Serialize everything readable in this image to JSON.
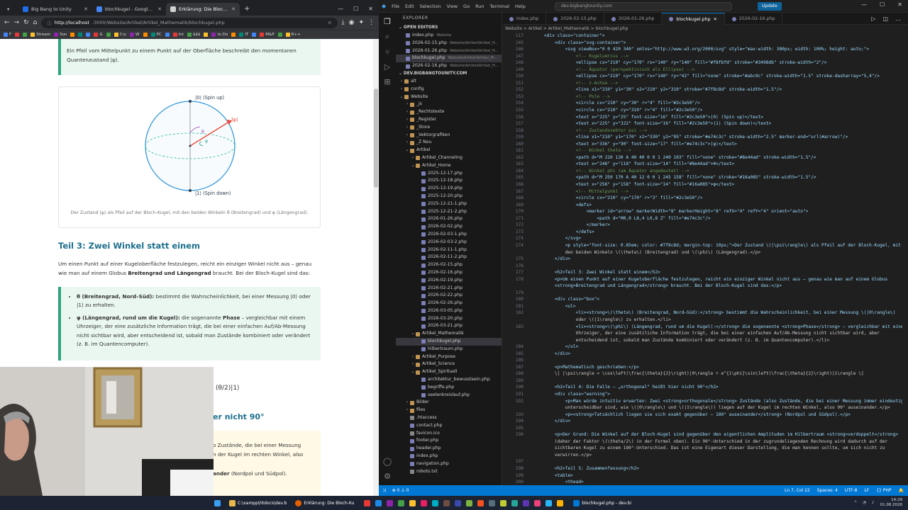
{
  "browser": {
    "tabs": [
      {
        "label": "Big Bang to Unity",
        "color": "#1f6feb"
      },
      {
        "label": "blochkugel - Google Suche",
        "color": "#4285f4"
      },
      {
        "label": "Erklärung: Die Bloch-Kugel",
        "color": "#d0d0d0"
      }
    ],
    "url_host": "http://localhost",
    "url_path": ":3000/Website/Artikel/Artikel_Mathematik/blochkugel.php",
    "bookmarks": [
      "F",
      "",
      "",
      "Stream",
      "Son",
      "",
      "",
      "",
      "G",
      "",
      "Cry",
      "W",
      "",
      "PC",
      "",
      "Int",
      "$$$",
      "",
      "to Do",
      "",
      "IT",
      "",
      "M&P",
      "",
      "R++"
    ],
    "content": {
      "intro": "Ein Pfeil vom Mittelpunkt zu einem Punkt auf der Oberfläche beschreibt den momentanen Quantenzustand |ψ⟩.",
      "fig_labels": {
        "top": "|0⟩ (Spin up)",
        "bottom": "|1⟩ (Spin down)",
        "psi": "|ψ⟩",
        "theta": "θ",
        "phi": "φ"
      },
      "fig_caption": "Der Zustand |ψ⟩ als Pfeil auf der Bloch-Kugel, mit den beiden Winkeln θ (Breitengrad) und φ (Längengrad).",
      "heading3": "Teil 3: Zwei Winkel statt einem",
      "para_pre": "Um einen Punkt auf einer Kugeloberfläche festzulegen, reicht ein einziger Winkel nicht aus – genau wie man auf einem Globus ",
      "para_bold": "Breitengrad und Längengrad",
      "para_post": " braucht. Bei der Bloch-Kugel sind das:",
      "li1_bold": "θ (Breitengrad, Nord–Süd):",
      "li1_text": " bestimmt die Wahrscheinlichkeit, bei einer Messung |0⟩ oder |1⟩ zu erhalten.",
      "li2_bold": "φ (Längengrad, rund um die Kugel):",
      "li2_text": " die sogenannte ",
      "li2_bold2": "Phase",
      "li2_text2": " – vergleichbar mit einem Uhrzeiger, der eine zusätzliche Information trägt, die bei einer einfachen Auf/Ab-Messung nicht sichtbar wird, aber entscheidend ist, sobald man Zustände kombiniert oder verändert (z. B. im Quantencomputer).",
      "formula_frag": "(θ/2)|1⟩",
      "heading4_frag": "er nicht 90°",
      "warn1": "o Zustände, die bei einer Messung",
      "warn2": "n der Kugel im rechten Winkel, also",
      "warn3_bold": "ander",
      "warn3_text": " (Nordpol und Südpol)."
    }
  },
  "vscode": {
    "menu": [
      "File",
      "Edit",
      "Selection",
      "View",
      "Go",
      "Run",
      "Terminal",
      "Help"
    ],
    "search": "dev.bigbangtounity.com",
    "update_label": "Update",
    "explorer_title": "EXPLORER",
    "open_editors_title": "OPEN EDITORS",
    "open_editors": [
      {
        "name": "index.php",
        "note": "Website"
      },
      {
        "name": "2026-02-15.php",
        "note": "Website\\Artikel\\Artikel_H..."
      },
      {
        "name": "2026-01-26.php",
        "note": "Website\\Artikel\\Artikel_H..."
      },
      {
        "name": "blochkugel.php",
        "note": "Website\\Artikel\\Artikel_M..."
      },
      {
        "name": "2026-02-16.php",
        "note": "Website\\Artikel\\Artikel_H..."
      }
    ],
    "project_title": "DEV.BIGBANGTOUNITY.COM",
    "tree": [
      {
        "d": 0,
        "t": "f",
        "n": "alt"
      },
      {
        "d": 0,
        "t": "f",
        "n": "config"
      },
      {
        "d": 0,
        "t": "o",
        "n": "Website"
      },
      {
        "d": 1,
        "t": "f",
        "n": "_js"
      },
      {
        "d": 1,
        "t": "f",
        "n": "_Rechtstexte"
      },
      {
        "d": 1,
        "t": "f",
        "n": "_Register"
      },
      {
        "d": 1,
        "t": "f",
        "n": "_Store"
      },
      {
        "d": 1,
        "t": "f",
        "n": "_Vektorgrafiken"
      },
      {
        "d": 1,
        "t": "f",
        "n": "_Z Neu"
      },
      {
        "d": 1,
        "t": "o",
        "n": "Artikel"
      },
      {
        "d": 2,
        "t": "f",
        "n": "Artikel_Channeling"
      },
      {
        "d": 2,
        "t": "o",
        "n": "Artikel_Home"
      },
      {
        "d": 3,
        "t": "p",
        "n": "2025-12-17.php"
      },
      {
        "d": 3,
        "t": "p",
        "n": "2025-12-18.php"
      },
      {
        "d": 3,
        "t": "p",
        "n": "2025-12-19.php"
      },
      {
        "d": 3,
        "t": "p",
        "n": "2025-12-20.php"
      },
      {
        "d": 3,
        "t": "p",
        "n": "2025-12-21-1.php"
      },
      {
        "d": 3,
        "t": "p",
        "n": "2025-12-21-2.php"
      },
      {
        "d": 3,
        "t": "p",
        "n": "2026-01-26.php"
      },
      {
        "d": 3,
        "t": "p",
        "n": "2026-02-02.php"
      },
      {
        "d": 3,
        "t": "p",
        "n": "2026-02-03-1.php"
      },
      {
        "d": 3,
        "t": "p",
        "n": "2026-02-03-2.php"
      },
      {
        "d": 3,
        "t": "p",
        "n": "2026-02-11-1.php"
      },
      {
        "d": 3,
        "t": "p",
        "n": "2026-02-11-2.php"
      },
      {
        "d": 3,
        "t": "p",
        "n": "2026-02-15.php"
      },
      {
        "d": 3,
        "t": "p",
        "n": "2026-02-16.php"
      },
      {
        "d": 3,
        "t": "p",
        "n": "2026-02-19.php"
      },
      {
        "d": 3,
        "t": "p",
        "n": "2026-02-21.php"
      },
      {
        "d": 3,
        "t": "p",
        "n": "2026-02-22.php"
      },
      {
        "d": 3,
        "t": "p",
        "n": "2026-02-26.php"
      },
      {
        "d": 3,
        "t": "p",
        "n": "2026-03-05.php"
      },
      {
        "d": 3,
        "t": "p",
        "n": "2026-03-20.php"
      },
      {
        "d": 3,
        "t": "p",
        "n": "2026-03-21.php"
      },
      {
        "d": 2,
        "t": "o",
        "n": "Artikel_Mathematik"
      },
      {
        "d": 3,
        "t": "p",
        "n": "blochkugel.php",
        "sel": true
      },
      {
        "d": 3,
        "t": "p",
        "n": "hilbertraum.php"
      },
      {
        "d": 2,
        "t": "f",
        "n": "Artikel_Purpose"
      },
      {
        "d": 2,
        "t": "f",
        "n": "Artikel_Science"
      },
      {
        "d": 2,
        "t": "o",
        "n": "Artikel_Spirituell"
      },
      {
        "d": 3,
        "t": "p",
        "n": "architektur_bewusstsein.php"
      },
      {
        "d": 3,
        "t": "p",
        "n": "begriffe.php"
      },
      {
        "d": 3,
        "t": "p",
        "n": "seelenkreislauf.php"
      },
      {
        "d": 1,
        "t": "f",
        "n": "Bilder"
      },
      {
        "d": 1,
        "t": "f",
        "n": "files"
      },
      {
        "d": 1,
        "t": "x",
        "n": ".htaccess"
      },
      {
        "d": 1,
        "t": "p",
        "n": "contact.php"
      },
      {
        "d": 1,
        "t": "x",
        "n": "favicon.ico"
      },
      {
        "d": 1,
        "t": "p",
        "n": "footer.php"
      },
      {
        "d": 1,
        "t": "p",
        "n": "header.php"
      },
      {
        "d": 1,
        "t": "p",
        "n": "index.php"
      },
      {
        "d": 1,
        "t": "p",
        "n": "navigation.php"
      },
      {
        "d": 1,
        "t": "x",
        "n": "robots.txt"
      }
    ],
    "tabs": [
      {
        "name": "index.php"
      },
      {
        "name": "2026-02-15.php"
      },
      {
        "name": "2026-01-26.php"
      },
      {
        "name": "blochkugel.php",
        "active": true
      },
      {
        "name": "2026-02-16.php"
      }
    ],
    "breadcrumb": "Website > Artikel > Artikel_Mathematik > blochkugel.php",
    "code": [
      {
        "n": "117",
        "l": "    <div class=\"container\">"
      },
      {
        "n": "145",
        "l": "        <div class=\"svg-container\">"
      },
      {
        "n": "146",
        "l": "            <svg viewBox=\"0 0 420 340\" xmlns=\"http://www.w3.org/2000/svg\" style=\"max-width: 380px; width: 100%; height: auto;\">"
      },
      {
        "n": "147",
        "l": "                <!-- Kugelumriss -->"
      },
      {
        "n": "148",
        "l": "                <ellipse cx=\"210\" cy=\"170\" rx=\"140\" ry=\"140\" fill=\"#f8fbfd\" stroke=\"#3498db\" stroke-width=\"2\"/>"
      },
      {
        "n": "149",
        "l": "                <!-- Äquator (perspektivisch als Ellipse) -->"
      },
      {
        "n": "150",
        "l": "                <ellipse cx=\"210\" cy=\"170\" rx=\"140\" ry=\"42\" fill=\"none\" stroke=\"#abc9c\" stroke-width=\"1.5\" stroke-dasharray=\"5,4\"/>"
      },
      {
        "n": "151",
        "l": "                <!-- z-Achse -->"
      },
      {
        "n": "152",
        "l": "                <line x1=\"210\" y1=\"30\" x2=\"210\" y2=\"310\" stroke=\"#7f8c8d\" stroke-width=\"1.5\"/>"
      },
      {
        "n": "153",
        "l": "                <!-- Pole -->"
      },
      {
        "n": "154",
        "l": "                <circle cx=\"210\" cy=\"30\" r=\"4\" fill=\"#2c3e50\"/>"
      },
      {
        "n": "155",
        "l": "                <circle cx=\"210\" cy=\"310\" r=\"4\" fill=\"#2c3e50\"/>"
      },
      {
        "n": "156",
        "l": "                <text x=\"225\" y=\"25\" font-size=\"16\" fill=\"#2c3e50\">|0⟩ (Spin up)</text>"
      },
      {
        "n": "157",
        "l": "                <text x=\"225\" y=\"322\" font-size=\"16\" fill=\"#2c3e50\">|1⟩ (Spin down)</text>"
      },
      {
        "n": "158",
        "l": "                <!-- Zustandsvektor psi -->"
      },
      {
        "n": "159",
        "l": "                <line x1=\"210\" y1=\"170\" x2=\"330\" y2=\"95\" stroke=\"#e74c3c\" stroke-width=\"2.5\" marker-end=\"url(#arrow)\"/>"
      },
      {
        "n": "160",
        "l": "                <text x=\"336\" y=\"90\" font-size=\"17\" fill=\"#e74c3c\">|ψ⟩</text>"
      },
      {
        "n": "161",
        "l": "                <!-- Winkel theta -->"
      },
      {
        "n": "162",
        "l": "                <path d=\"M 210 130 A 40 40 0 0 1 240 103\" fill=\"none\" stroke=\"#8e44ad\" stroke-width=\"1.5\"/>"
      },
      {
        "n": "163",
        "l": "                <text x=\"246\" y=\"118\" font-size=\"14\" fill=\"#8e44ad\">θ</text>"
      },
      {
        "n": "164",
        "l": "                <!-- Winkel phi (am Äquator angedeutet) -->"
      },
      {
        "n": "165",
        "l": "                <path d=\"M 250 170 A 40 12 0 0 1 245 158\" fill=\"none\" stroke=\"#16a085\" stroke-width=\"1.5\"/>"
      },
      {
        "n": "166",
        "l": "                <text x=\"256\" y=\"158\" font-size=\"14\" fill=\"#16a085\">φ</text>"
      },
      {
        "n": "167",
        "l": "                <!-- Mittelpunkt -->"
      },
      {
        "n": "168",
        "l": "                <circle cx=\"210\" cy=\"170\" r=\"3\" fill=\"#2c3e50\"/>"
      },
      {
        "n": "169",
        "l": "                <defs>"
      },
      {
        "n": "170",
        "l": "                    <marker id=\"arrow\" markerWidth=\"8\" markerHeight=\"8\" refX=\"4\" refY=\"4\" orient=\"auto\">"
      },
      {
        "n": "171",
        "l": "                        <path d=\"M0,0 L8,4 L0,8 Z\" fill=\"#e74c3c\"/>"
      },
      {
        "n": "172",
        "l": "                    </marker>"
      },
      {
        "n": "173",
        "l": "                </defs>"
      },
      {
        "n": "174",
        "l": "            </svg>"
      },
      {
        "n": "174",
        "l": "            <p style=\"font-size: 0.85em; color: #7f8c8d; margin-top: 10px;\">Der Zustand \\(|\\psi\\rangle\\) als Pfeil auf der Bloch-Kugel, mit"
      },
      {
        "n": "",
        "l": "            den beiden Winkeln \\(\\theta\\) (Breitengrad) und \\(\\phi\\) (Längengrad).</p>"
      },
      {
        "n": "175",
        "l": "        </div>"
      },
      {
        "n": "176",
        "l": ""
      },
      {
        "n": "177",
        "l": "        <h2>Teil 3: Zwei Winkel statt einem</h2>"
      },
      {
        "n": "178",
        "l": "        <p>Um einen Punkt auf einer Kugeloberfläche festzulegen, reicht ein einziger Winkel nicht aus – genau wie man auf einem Globus"
      },
      {
        "n": "",
        "l": "        <strong>Breitengrad und Längengrad</strong> braucht. Bei der Bloch-Kugel sind das:</p>"
      },
      {
        "n": "179",
        "l": ""
      },
      {
        "n": "180",
        "l": "        <div class=\"box\">"
      },
      {
        "n": "181",
        "l": "            <ul>"
      },
      {
        "n": "182",
        "l": "                <li><strong>\\(\\theta\\) (Breitengrad, Nord–Süd):</strong> bestimmt die Wahrscheinlichkeit, bei einer Messung \\(|0\\rangle\\)"
      },
      {
        "n": "",
        "l": "                oder \\(|1\\rangle\\) zu erhalten.</li>"
      },
      {
        "n": "183",
        "l": "                <li><strong>\\(\\phi\\) (Längengrad, rund um die Kugel):</strong> die sogenannte <strong>Phase</strong> – vergleichbar mit einem"
      },
      {
        "n": "",
        "l": "                Uhrzeiger, der eine zusätzliche Information trägt, die bei einer einfachen Auf/Ab-Messung nicht sichtbar wird, aber"
      },
      {
        "n": "",
        "l": "                entscheidend ist, sobald man Zustände kombiniert oder verändert (z. B. im Quantencomputer).</li>"
      },
      {
        "n": "184",
        "l": "            </ul>"
      },
      {
        "n": "185",
        "l": "        </div>"
      },
      {
        "n": "186",
        "l": ""
      },
      {
        "n": "187",
        "l": "        <p>Mathematisch geschrieben:</p>"
      },
      {
        "n": "188",
        "l": "        \\[ |\\psi\\rangle = \\cos\\left(\\frac{\\theta}{2}\\right)|0\\rangle + e^{i\\phi}\\sin\\left(\\frac{\\theta}{2}\\right)|1\\rangle \\]"
      },
      {
        "n": "189",
        "l": ""
      },
      {
        "n": "190",
        "l": "        <h2>Teil 4: Die Falle – „orthogonal\" heißt hier nicht 90°</h2>"
      },
      {
        "n": "191",
        "l": "        <div class=\"warning\">"
      },
      {
        "n": "192",
        "l": "            <p>Man würde intuitiv erwarten: Zwei <strong>orthogonale</strong> Zustände (also Zustände, die bei einer Messung immer eindeutig"
      },
      {
        "n": "",
        "l": "            unterscheidbar sind, wie \\(|0\\rangle\\) und \\(|1\\rangle\\)) liegen auf der Kugel im rechten Winkel, also 90° auseinander.</p>"
      },
      {
        "n": "193",
        "l": "            <p><strong>Tatsächlich liegen sie sich exakt gegenüber – 180° auseinander</strong> (Nordpol und Südpol).</p>"
      },
      {
        "n": "194",
        "l": "        </div>"
      },
      {
        "n": "195",
        "l": ""
      },
      {
        "n": "196",
        "l": "        <p>Der Grund: Die Winkel auf der Bloch-Kugel sind gegenüber den eigentlichen Amplituden im Hilbertraum <strong>verdoppelt</strong>"
      },
      {
        "n": "",
        "l": "        (daher der Faktor \\(\\theta/2\\) in der Formel oben). Ein 90°-Unterschied in der zugrundeliegenden Rechnung wird dadurch auf der"
      },
      {
        "n": "",
        "l": "        sichtbaren Kugel zu einem 180°-Unterschied. Das ist eine Eigenart dieser Darstellung, die man kennen sollte, um sich nicht zu"
      },
      {
        "n": "",
        "l": "        verwirren.</p>"
      },
      {
        "n": "197",
        "l": ""
      },
      {
        "n": "198",
        "l": "        <h2>Teil 5: Zusammenfassung</h2>"
      },
      {
        "n": "199",
        "l": "        <table>"
      },
      {
        "n": "200",
        "l": "            <thead>"
      }
    ],
    "status_left": "⊗ 0 ⚠ 0",
    "status_right": [
      "Ln 7, Col 22",
      "Spaces: 4",
      "UTF-8",
      "LF",
      "{} PHP"
    ]
  },
  "taskbar": {
    "items": [
      {
        "label": "C:\\xampp\\htdocs\\dev.b",
        "color": "#e8b84b"
      },
      {
        "label": "Erklärung: Die Bloch-Ku",
        "color": "#e66000"
      },
      {
        "label": "blochkugel.php - dev.bi",
        "color": "#0078d4"
      }
    ],
    "time": "14:29",
    "date": "01.08.2026"
  }
}
